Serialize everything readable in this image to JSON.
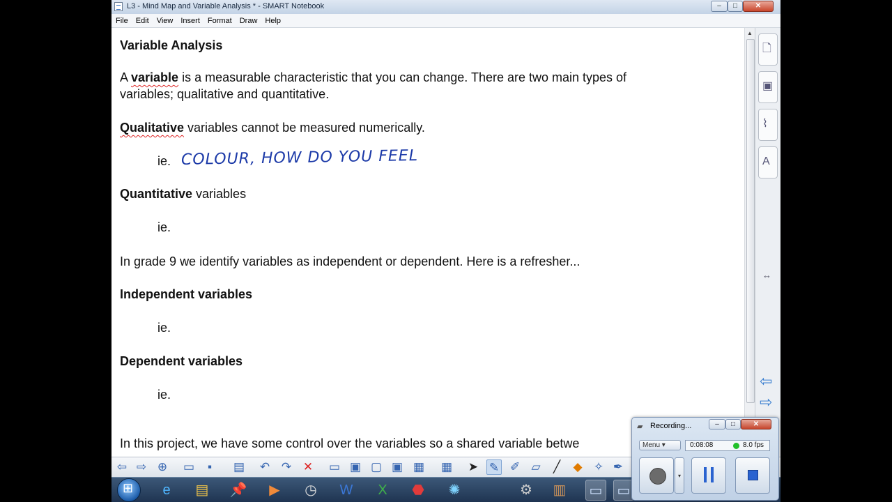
{
  "window": {
    "title": "L3 - Mind Map and Variable Analysis * - SMART Notebook",
    "minimize": "–",
    "maximize": "□",
    "close": "✕"
  },
  "menubar": [
    "File",
    "Edit",
    "View",
    "Insert",
    "Format",
    "Draw",
    "Help"
  ],
  "document": {
    "heading": "Variable Analysis",
    "intro_a": "A ",
    "intro_bold": "variable",
    "intro_b": " is a measurable characteristic that you can change.  There are two main types of",
    "intro_line2": "variables; qualitative and quantitative.",
    "qual_bold": "Qualitative",
    "qual_rest": " variables cannot be measured numerically.",
    "ie": "ie.",
    "handwriting": "COLOUR, HOW DO YOU FEEL",
    "quant_bold": "Quantitative",
    "quant_rest": " variables",
    "grade_line": "In grade 9 we identify variables as independent or dependent.  Here is a refresher...",
    "independent": "Independent variables",
    "dependent": "Dependent variables",
    "project_line": "In this project, we have some control over the variables so a shared variable betwe"
  },
  "side_panel": {
    "icons": [
      "page-sorter-icon",
      "gallery-icon",
      "attachments-icon",
      "properties-icon"
    ],
    "resize_glyph": "↔",
    "back_glyph": "⇦",
    "forward_glyph": "⇨"
  },
  "toolbar_icons": [
    "back-arrow-icon",
    "forward-arrow-icon",
    "add-page-icon",
    "open-icon",
    "save-icon",
    "paste-icon",
    "undo-icon",
    "redo-icon",
    "delete-icon",
    "screen-shade-icon",
    "display-icon",
    "capture-icon",
    "capture-area-icon",
    "screen-capture-icon",
    "table-icon",
    "select-icon",
    "pen-icon",
    "creative-pen-icon",
    "eraser-icon",
    "line-icon",
    "shape-icon",
    "magic-pen-icon",
    "fill-icon",
    "text-icon"
  ],
  "taskbar_icons": [
    "start-button",
    "ie-icon",
    "explorer-icon",
    "pin-icon",
    "media-player-icon",
    "clock-icon",
    "word-icon",
    "excel-icon",
    "acrobat-icon",
    "network-icon",
    "version-icon",
    "books-icon",
    "notebook-icon",
    "recorder-icon"
  ],
  "recorder": {
    "title": "Recording...",
    "menu": "Menu",
    "elapsed": "0:08:08",
    "fps": "8.0 fps",
    "status_color": "#22c02a"
  }
}
